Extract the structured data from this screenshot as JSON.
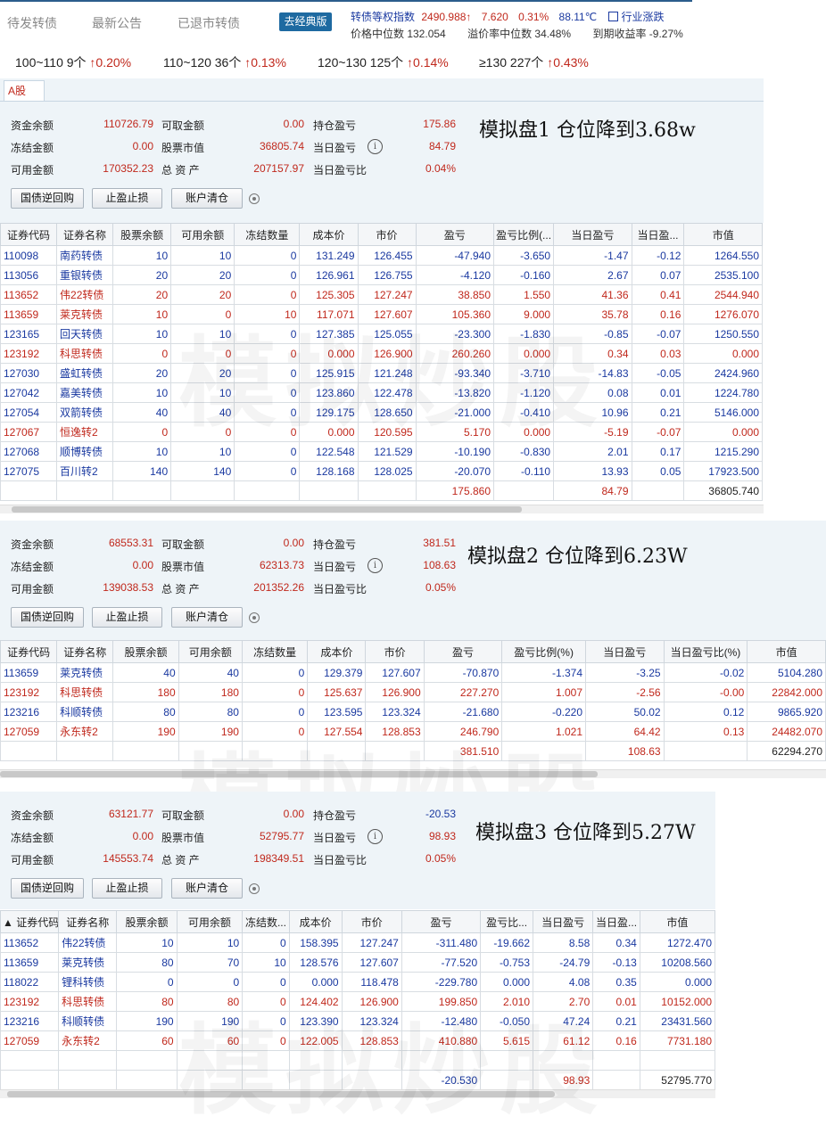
{
  "topnav": {
    "tab1": "待发转债",
    "tab2": "最新公告",
    "tab3": "已退市转债",
    "classic_btn": "去经典版"
  },
  "index": {
    "name": "转债等权指数",
    "value": "2490.988",
    "arrow": "↑",
    "change": "7.620",
    "pct": "0.31%",
    "temp": "88.11℃",
    "industry": "行业涨跌"
  },
  "stats": {
    "price_median": "价格中位数 132.054",
    "premium_median": "溢价率中位数 34.48%",
    "ytm": "到期收益率 -9.27%"
  },
  "buckets": [
    {
      "range": "100~110 9个",
      "change": "↑0.20%"
    },
    {
      "range": "110~120 36个",
      "change": "↑0.13%"
    },
    {
      "range": "120~130 125个",
      "change": "↑0.14%"
    },
    {
      "range": "≥130 227个",
      "change": "↑0.43%"
    }
  ],
  "tab_label": "A股",
  "labels": {
    "cash": "资金余额",
    "withdraw": "可取金额",
    "pos_pl": "持仓盈亏",
    "frozen": "冻结金额",
    "stock_val": "股票市值",
    "day_pl": "当日盈亏",
    "avail": "可用金额",
    "total": "总 资 产",
    "day_pct": "当日盈亏比",
    "btn1": "国债逆回购",
    "btn2": "止盈止损",
    "btn3": "账户清仓",
    "info": "i"
  },
  "panels": [
    {
      "cash": "110726.79",
      "withdraw": "0.00",
      "pos_pl": "175.86",
      "frozen": "0.00",
      "stock_val": "36805.74",
      "day_pl": "84.79",
      "avail": "170352.23",
      "total": "207157.97",
      "day_pct": "0.04%",
      "note": "模拟盘1 仓位降到3.68w",
      "headers": [
        "证券代码",
        "证券名称",
        "股票余额",
        "可用余额",
        "冻结数量",
        "成本价",
        "市价",
        "盈亏",
        "盈亏比例(...",
        "当日盈亏",
        "当日盈...",
        "市值"
      ],
      "rows": [
        {
          "color": "blue",
          "cells": [
            "110098",
            "南药转债",
            "10",
            "10",
            "0",
            "131.249",
            "126.455",
            "-47.940",
            "-3.650",
            "-1.47",
            "-0.12",
            "1264.550"
          ]
        },
        {
          "color": "blue",
          "cells": [
            "113056",
            "重银转债",
            "20",
            "20",
            "0",
            "126.961",
            "126.755",
            "-4.120",
            "-0.160",
            "2.67",
            "0.07",
            "2535.100"
          ]
        },
        {
          "color": "red",
          "cells": [
            "113652",
            "伟22转债",
            "20",
            "20",
            "0",
            "125.305",
            "127.247",
            "38.850",
            "1.550",
            "41.36",
            "0.41",
            "2544.940"
          ]
        },
        {
          "color": "red",
          "cells": [
            "113659",
            "莱克转债",
            "10",
            "0",
            "10",
            "117.071",
            "127.607",
            "105.360",
            "9.000",
            "35.78",
            "0.16",
            "1276.070"
          ]
        },
        {
          "color": "blue",
          "cells": [
            "123165",
            "回天转债",
            "10",
            "10",
            "0",
            "127.385",
            "125.055",
            "-23.300",
            "-1.830",
            "-0.85",
            "-0.07",
            "1250.550"
          ]
        },
        {
          "color": "red",
          "cells": [
            "123192",
            "科思转债",
            "0",
            "0",
            "0",
            "0.000",
            "126.900",
            "260.260",
            "0.000",
            "0.34",
            "0.03",
            "0.000"
          ]
        },
        {
          "color": "blue",
          "cells": [
            "127030",
            "盛虹转债",
            "20",
            "20",
            "0",
            "125.915",
            "121.248",
            "-93.340",
            "-3.710",
            "-14.83",
            "-0.05",
            "2424.960"
          ]
        },
        {
          "color": "blue",
          "cells": [
            "127042",
            "嘉美转债",
            "10",
            "10",
            "0",
            "123.860",
            "122.478",
            "-13.820",
            "-1.120",
            "0.08",
            "0.01",
            "1224.780"
          ]
        },
        {
          "color": "blue",
          "cells": [
            "127054",
            "双箭转债",
            "40",
            "40",
            "0",
            "129.175",
            "128.650",
            "-21.000",
            "-0.410",
            "10.96",
            "0.21",
            "5146.000"
          ]
        },
        {
          "color": "red",
          "cells": [
            "127067",
            "恒逸转2",
            "0",
            "0",
            "0",
            "0.000",
            "120.595",
            "5.170",
            "0.000",
            "-5.19",
            "-0.07",
            "0.000"
          ]
        },
        {
          "color": "blue",
          "cells": [
            "127068",
            "顺博转债",
            "10",
            "10",
            "0",
            "122.548",
            "121.529",
            "-10.190",
            "-0.830",
            "2.01",
            "0.17",
            "1215.290"
          ]
        },
        {
          "color": "blue",
          "cells": [
            "127075",
            "百川转2",
            "140",
            "140",
            "0",
            "128.168",
            "128.025",
            "-20.070",
            "-0.110",
            "13.93",
            "0.05",
            "17923.500"
          ]
        }
      ],
      "total_row": [
        "",
        "",
        "",
        "",
        "",
        "",
        "",
        "175.860",
        "",
        "84.79",
        "",
        "36805.740"
      ]
    },
    {
      "cash": "68553.31",
      "withdraw": "0.00",
      "pos_pl": "381.51",
      "frozen": "0.00",
      "stock_val": "62313.73",
      "day_pl": "108.63",
      "avail": "139038.53",
      "total": "201352.26",
      "day_pct": "0.05%",
      "note": "模拟盘2 仓位降到6.23W",
      "headers": [
        "证券代码",
        "证券名称",
        "股票余额",
        "可用余额",
        "冻结数量",
        "成本价",
        "市价",
        "盈亏",
        "盈亏比例(%)",
        "当日盈亏",
        "当日盈亏比(%)",
        "市值"
      ],
      "rows": [
        {
          "color": "blue",
          "cells": [
            "113659",
            "莱克转债",
            "40",
            "40",
            "0",
            "129.379",
            "127.607",
            "-70.870",
            "-1.374",
            "-3.25",
            "-0.02",
            "5104.280"
          ]
        },
        {
          "color": "red",
          "cells": [
            "123192",
            "科思转债",
            "180",
            "180",
            "0",
            "125.637",
            "126.900",
            "227.270",
            "1.007",
            "-2.56",
            "-0.00",
            "22842.000"
          ]
        },
        {
          "color": "blue",
          "cells": [
            "123216",
            "科顺转债",
            "80",
            "80",
            "0",
            "123.595",
            "123.324",
            "-21.680",
            "-0.220",
            "50.02",
            "0.12",
            "9865.920"
          ]
        },
        {
          "color": "red",
          "cells": [
            "127059",
            "永东转2",
            "190",
            "190",
            "0",
            "127.554",
            "128.853",
            "246.790",
            "1.021",
            "64.42",
            "0.13",
            "24482.070"
          ]
        }
      ],
      "total_row": [
        "",
        "",
        "",
        "",
        "",
        "",
        "",
        "381.510",
        "",
        "108.63",
        "",
        "62294.270"
      ]
    },
    {
      "cash": "63121.77",
      "withdraw": "0.00",
      "pos_pl": "-20.53",
      "frozen": "0.00",
      "stock_val": "52795.77",
      "day_pl": "98.93",
      "avail": "145553.74",
      "total": "198349.51",
      "day_pct": "0.05%",
      "note": "模拟盘3 仓位降到5.27W",
      "headers": [
        "▲ 证券代码",
        "证券名称",
        "股票余额",
        "可用余额",
        "冻结数...",
        "成本价",
        "市价",
        "盈亏",
        "盈亏比...",
        "当日盈亏",
        "当日盈...",
        "市值"
      ],
      "rows": [
        {
          "color": "blue",
          "cells": [
            "113652",
            "伟22转债",
            "10",
            "10",
            "0",
            "158.395",
            "127.247",
            "-311.480",
            "-19.662",
            "8.58",
            "0.34",
            "1272.470"
          ]
        },
        {
          "color": "blue",
          "cells": [
            "113659",
            "莱克转债",
            "80",
            "70",
            "10",
            "128.576",
            "127.607",
            "-77.520",
            "-0.753",
            "-24.79",
            "-0.13",
            "10208.560"
          ]
        },
        {
          "color": "blue",
          "cells": [
            "118022",
            "锂科转债",
            "0",
            "0",
            "0",
            "0.000",
            "118.478",
            "-229.780",
            "0.000",
            "4.08",
            "0.35",
            "0.000"
          ]
        },
        {
          "color": "red",
          "cells": [
            "123192",
            "科思转债",
            "80",
            "80",
            "0",
            "124.402",
            "126.900",
            "199.850",
            "2.010",
            "2.70",
            "0.01",
            "10152.000"
          ]
        },
        {
          "color": "blue",
          "cells": [
            "123216",
            "科顺转债",
            "190",
            "190",
            "0",
            "123.390",
            "123.324",
            "-12.480",
            "-0.050",
            "47.24",
            "0.21",
            "23431.560"
          ]
        },
        {
          "color": "red",
          "cells": [
            "127059",
            "永东转2",
            "60",
            "60",
            "0",
            "122.005",
            "128.853",
            "410.880",
            "5.615",
            "61.12",
            "0.16",
            "7731.180"
          ]
        }
      ],
      "total_row": [
        "",
        "",
        "",
        "",
        "",
        "",
        "",
        "-20.530",
        "",
        "98.93",
        "",
        "52795.770"
      ]
    }
  ],
  "watermark": "模拟炒股"
}
